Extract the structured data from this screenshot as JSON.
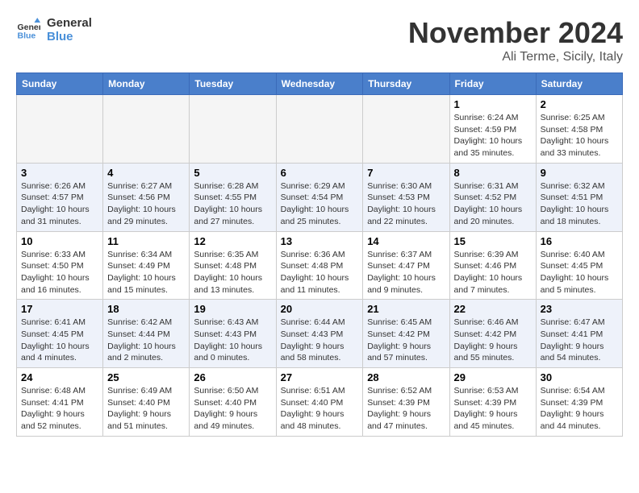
{
  "logo": {
    "line1": "General",
    "line2": "Blue"
  },
  "title": "November 2024",
  "location": "Ali Terme, Sicily, Italy",
  "weekdays": [
    "Sunday",
    "Monday",
    "Tuesday",
    "Wednesday",
    "Thursday",
    "Friday",
    "Saturday"
  ],
  "weeks": [
    [
      {
        "day": "",
        "info": ""
      },
      {
        "day": "",
        "info": ""
      },
      {
        "day": "",
        "info": ""
      },
      {
        "day": "",
        "info": ""
      },
      {
        "day": "",
        "info": ""
      },
      {
        "day": "1",
        "info": "Sunrise: 6:24 AM\nSunset: 4:59 PM\nDaylight: 10 hours\nand 35 minutes."
      },
      {
        "day": "2",
        "info": "Sunrise: 6:25 AM\nSunset: 4:58 PM\nDaylight: 10 hours\nand 33 minutes."
      }
    ],
    [
      {
        "day": "3",
        "info": "Sunrise: 6:26 AM\nSunset: 4:57 PM\nDaylight: 10 hours\nand 31 minutes."
      },
      {
        "day": "4",
        "info": "Sunrise: 6:27 AM\nSunset: 4:56 PM\nDaylight: 10 hours\nand 29 minutes."
      },
      {
        "day": "5",
        "info": "Sunrise: 6:28 AM\nSunset: 4:55 PM\nDaylight: 10 hours\nand 27 minutes."
      },
      {
        "day": "6",
        "info": "Sunrise: 6:29 AM\nSunset: 4:54 PM\nDaylight: 10 hours\nand 25 minutes."
      },
      {
        "day": "7",
        "info": "Sunrise: 6:30 AM\nSunset: 4:53 PM\nDaylight: 10 hours\nand 22 minutes."
      },
      {
        "day": "8",
        "info": "Sunrise: 6:31 AM\nSunset: 4:52 PM\nDaylight: 10 hours\nand 20 minutes."
      },
      {
        "day": "9",
        "info": "Sunrise: 6:32 AM\nSunset: 4:51 PM\nDaylight: 10 hours\nand 18 minutes."
      }
    ],
    [
      {
        "day": "10",
        "info": "Sunrise: 6:33 AM\nSunset: 4:50 PM\nDaylight: 10 hours\nand 16 minutes."
      },
      {
        "day": "11",
        "info": "Sunrise: 6:34 AM\nSunset: 4:49 PM\nDaylight: 10 hours\nand 15 minutes."
      },
      {
        "day": "12",
        "info": "Sunrise: 6:35 AM\nSunset: 4:48 PM\nDaylight: 10 hours\nand 13 minutes."
      },
      {
        "day": "13",
        "info": "Sunrise: 6:36 AM\nSunset: 4:48 PM\nDaylight: 10 hours\nand 11 minutes."
      },
      {
        "day": "14",
        "info": "Sunrise: 6:37 AM\nSunset: 4:47 PM\nDaylight: 10 hours\nand 9 minutes."
      },
      {
        "day": "15",
        "info": "Sunrise: 6:39 AM\nSunset: 4:46 PM\nDaylight: 10 hours\nand 7 minutes."
      },
      {
        "day": "16",
        "info": "Sunrise: 6:40 AM\nSunset: 4:45 PM\nDaylight: 10 hours\nand 5 minutes."
      }
    ],
    [
      {
        "day": "17",
        "info": "Sunrise: 6:41 AM\nSunset: 4:45 PM\nDaylight: 10 hours\nand 4 minutes."
      },
      {
        "day": "18",
        "info": "Sunrise: 6:42 AM\nSunset: 4:44 PM\nDaylight: 10 hours\nand 2 minutes."
      },
      {
        "day": "19",
        "info": "Sunrise: 6:43 AM\nSunset: 4:43 PM\nDaylight: 10 hours\nand 0 minutes."
      },
      {
        "day": "20",
        "info": "Sunrise: 6:44 AM\nSunset: 4:43 PM\nDaylight: 9 hours\nand 58 minutes."
      },
      {
        "day": "21",
        "info": "Sunrise: 6:45 AM\nSunset: 4:42 PM\nDaylight: 9 hours\nand 57 minutes."
      },
      {
        "day": "22",
        "info": "Sunrise: 6:46 AM\nSunset: 4:42 PM\nDaylight: 9 hours\nand 55 minutes."
      },
      {
        "day": "23",
        "info": "Sunrise: 6:47 AM\nSunset: 4:41 PM\nDaylight: 9 hours\nand 54 minutes."
      }
    ],
    [
      {
        "day": "24",
        "info": "Sunrise: 6:48 AM\nSunset: 4:41 PM\nDaylight: 9 hours\nand 52 minutes."
      },
      {
        "day": "25",
        "info": "Sunrise: 6:49 AM\nSunset: 4:40 PM\nDaylight: 9 hours\nand 51 minutes."
      },
      {
        "day": "26",
        "info": "Sunrise: 6:50 AM\nSunset: 4:40 PM\nDaylight: 9 hours\nand 49 minutes."
      },
      {
        "day": "27",
        "info": "Sunrise: 6:51 AM\nSunset: 4:40 PM\nDaylight: 9 hours\nand 48 minutes."
      },
      {
        "day": "28",
        "info": "Sunrise: 6:52 AM\nSunset: 4:39 PM\nDaylight: 9 hours\nand 47 minutes."
      },
      {
        "day": "29",
        "info": "Sunrise: 6:53 AM\nSunset: 4:39 PM\nDaylight: 9 hours\nand 45 minutes."
      },
      {
        "day": "30",
        "info": "Sunrise: 6:54 AM\nSunset: 4:39 PM\nDaylight: 9 hours\nand 44 minutes."
      }
    ]
  ]
}
